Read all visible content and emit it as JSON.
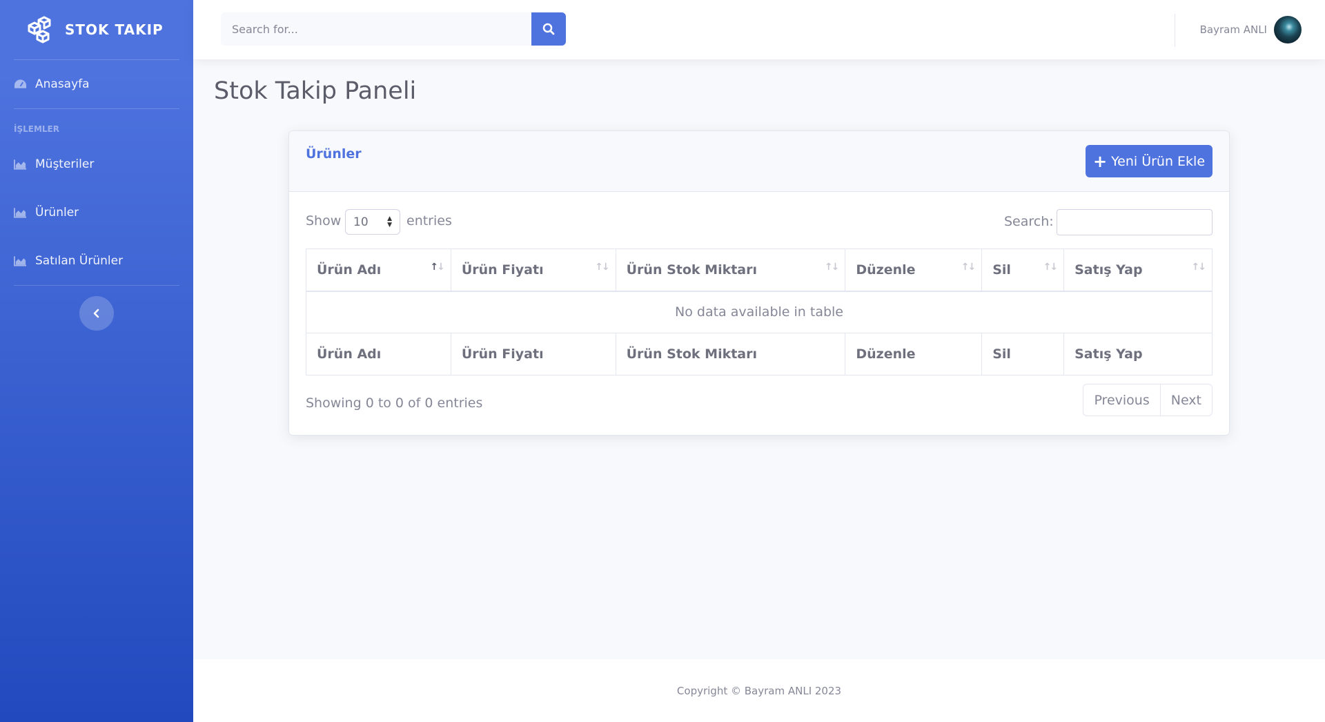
{
  "brand": {
    "name": "STOK TAKIP",
    "icon": "cubes-icon"
  },
  "sidebar": {
    "dashboard": {
      "label": "Anasayfa",
      "icon": "tachometer-icon"
    },
    "heading": "İŞLEMLER",
    "items": [
      {
        "label": "Müşteriler",
        "icon": "area-chart-icon"
      },
      {
        "label": "Ürünler",
        "icon": "area-chart-icon"
      },
      {
        "label": "Satılan Ürünler",
        "icon": "area-chart-icon"
      }
    ],
    "toggle_icon": "chevron-left-icon"
  },
  "topbar": {
    "search_placeholder": "Search for...",
    "search_icon": "search-icon",
    "user_name": "Bayram ANLI"
  },
  "page": {
    "title": "Stok Takip Paneli"
  },
  "card": {
    "title": "Ürünler",
    "add_button": "Yeni Ürün Ekle",
    "add_icon": "plus-icon"
  },
  "table": {
    "show_label": "Show",
    "entries_label": "entries",
    "page_length": "10",
    "search_label": "Search:",
    "columns": [
      "Ürün Adı",
      "Ürün Fiyatı",
      "Ürün Stok Miktarı",
      "Düzenle",
      "Sil",
      "Satış Yap"
    ],
    "empty_message": "No data available in table",
    "info": "Showing 0 to 0 of 0 entries",
    "previous": "Previous",
    "next": "Next"
  },
  "footer": {
    "copyright": "Copyright © Bayram ANLI 2023"
  },
  "colors": {
    "primary": "#4e73df",
    "primary_dark": "#224abe",
    "text_muted": "#858796",
    "background": "#f8f9fc"
  }
}
